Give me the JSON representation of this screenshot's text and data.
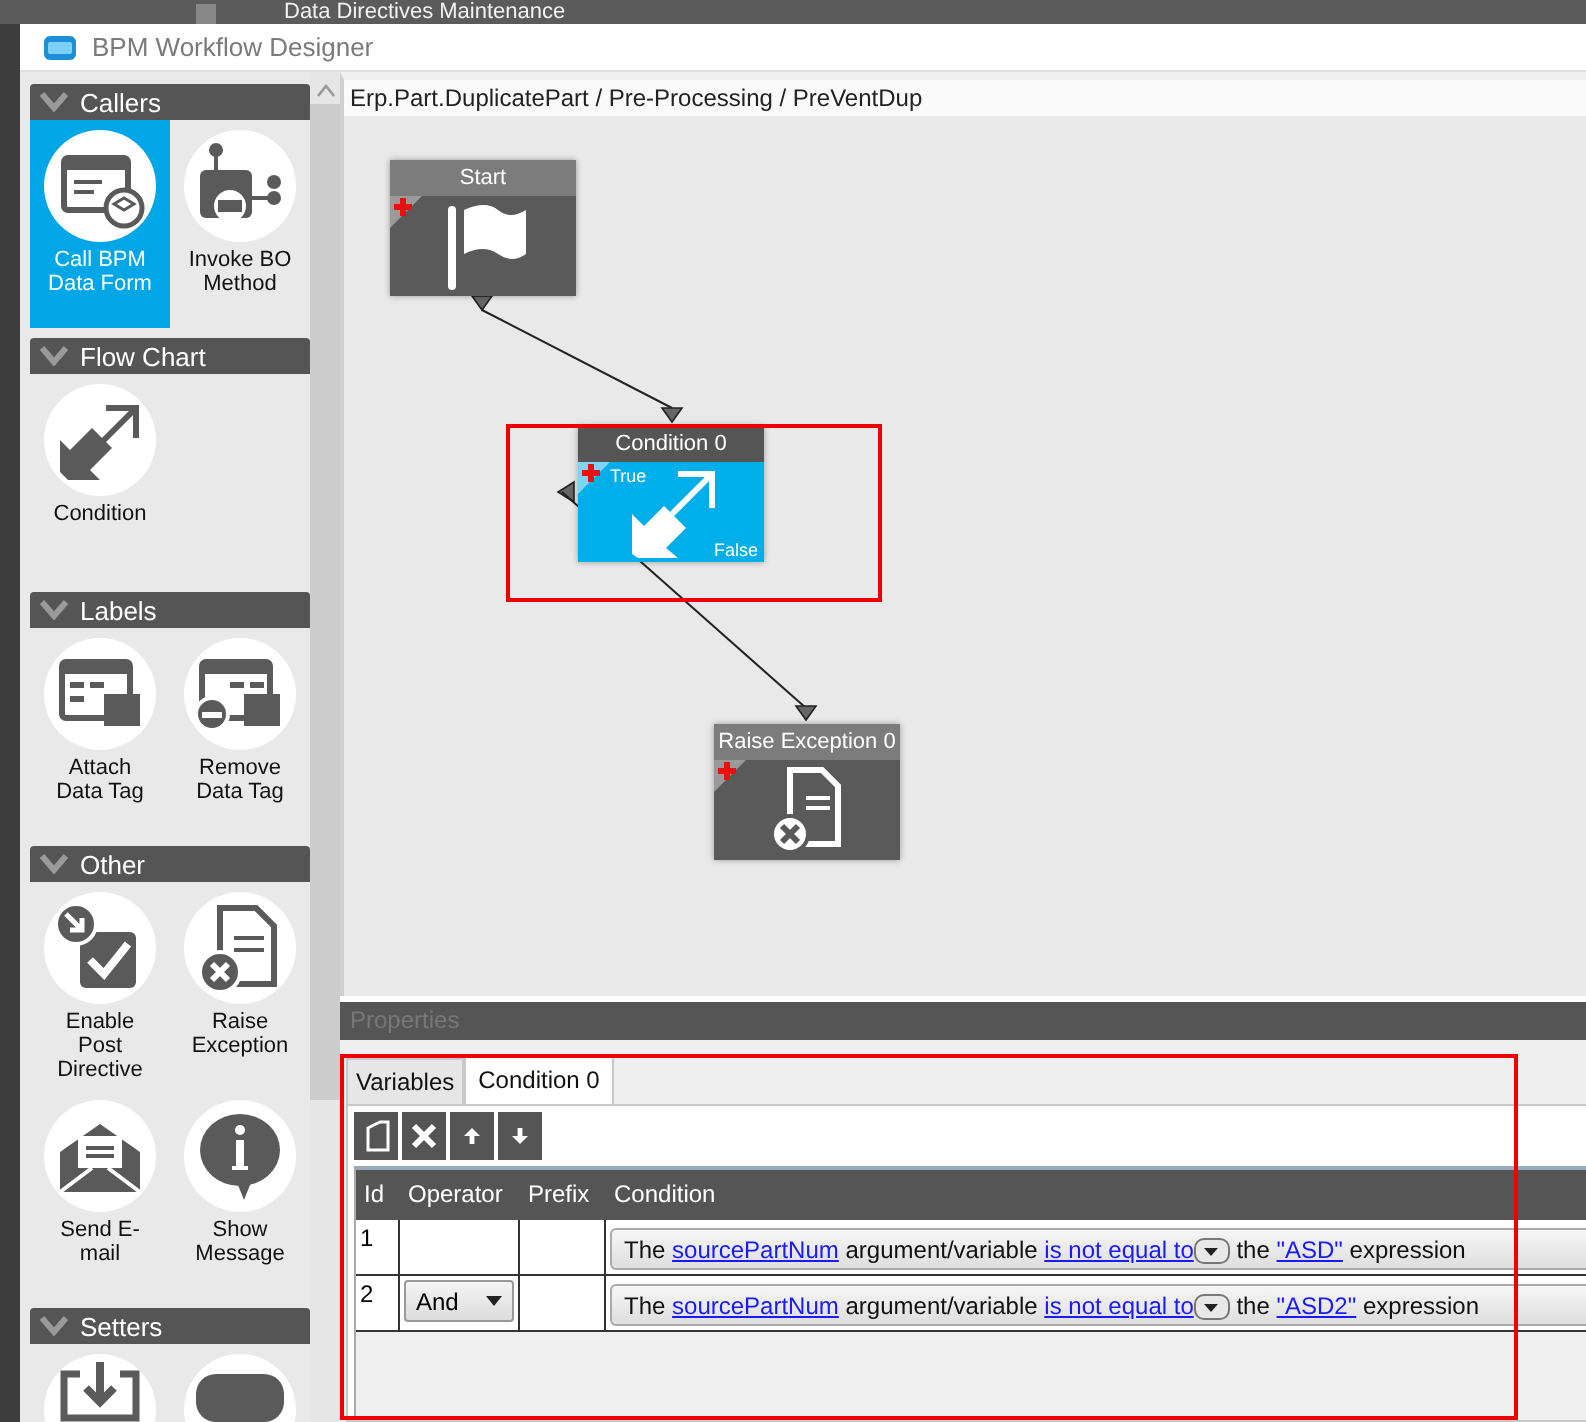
{
  "background_window": {
    "title": "Data Directives Maintenance"
  },
  "window": {
    "title": "BPM Workflow Designer"
  },
  "palette": {
    "sections": [
      {
        "title": "Callers",
        "expanded": true,
        "items": [
          {
            "label": "Call BPM Data Form",
            "kind": "call-form",
            "selected": true
          },
          {
            "label": "Invoke BO Method",
            "kind": "invoke-method",
            "selected": false
          }
        ]
      },
      {
        "title": "Flow Chart",
        "expanded": true,
        "items": [
          {
            "label": "Condition",
            "kind": "condition",
            "selected": false
          }
        ]
      },
      {
        "title": "Labels",
        "expanded": true,
        "items": [
          {
            "label": "Attach Data Tag",
            "kind": "attach-tag",
            "selected": false
          },
          {
            "label": "Remove Data Tag",
            "kind": "remove-tag",
            "selected": false
          }
        ]
      },
      {
        "title": "Other",
        "expanded": true,
        "items": [
          {
            "label": "Enable Post Directive",
            "kind": "enable-post",
            "selected": false
          },
          {
            "label": "Raise Exception",
            "kind": "raise-exception",
            "selected": false
          },
          {
            "label": "Send E-mail",
            "kind": "send-email",
            "selected": false
          },
          {
            "label": "Show Message",
            "kind": "show-message",
            "selected": false
          }
        ]
      },
      {
        "title": "Setters",
        "expanded": true,
        "items": [
          {
            "kind": "set-field",
            "selected": false
          },
          {
            "kind": "set-text",
            "selected": false
          }
        ]
      }
    ]
  },
  "breadcrumb": "Erp.Part.DuplicatePart / Pre-Processing / PreVentDup",
  "nodes": [
    {
      "title": "Start",
      "kind": "start",
      "selected": false
    },
    {
      "title": "Condition 0",
      "kind": "condition",
      "selected": true,
      "true_label": "True",
      "false_label": "False"
    },
    {
      "title": "Raise Exception 0",
      "kind": "exception",
      "selected": false
    }
  ],
  "properties": {
    "title": "Properties",
    "tabs": [
      {
        "label": "Variables",
        "selected": false
      },
      {
        "label": "Condition 0",
        "selected": true
      }
    ],
    "toolbar": [
      {
        "kind": "new"
      },
      {
        "kind": "delete"
      },
      {
        "kind": "up"
      },
      {
        "kind": "down"
      }
    ],
    "table": {
      "columns": [
        "Id",
        "Operator",
        "Prefix",
        "Condition"
      ],
      "rows": [
        {
          "id": "1",
          "condition": [
            {
              "kind": "text",
              "text": "The"
            },
            {
              "kind": "link",
              "text": "sourcePartNum"
            },
            {
              "kind": "text",
              "text": "argument/variable"
            },
            {
              "kind": "link",
              "text": "is not equal to"
            },
            {
              "kind": "dropdown"
            },
            {
              "kind": "text",
              "text": "the"
            },
            {
              "kind": "link",
              "text": "\"ASD\""
            },
            {
              "kind": "text",
              "text": "expression"
            }
          ]
        },
        {
          "id": "2",
          "operator": "And",
          "condition": [
            {
              "kind": "text",
              "text": "The"
            },
            {
              "kind": "link",
              "text": "sourcePartNum"
            },
            {
              "kind": "text",
              "text": "argument/variable"
            },
            {
              "kind": "link",
              "text": "is not equal to"
            },
            {
              "kind": "dropdown"
            },
            {
              "kind": "text",
              "text": "the"
            },
            {
              "kind": "link",
              "text": "\"ASD2\""
            },
            {
              "kind": "text",
              "text": "expression"
            }
          ]
        }
      ]
    }
  }
}
